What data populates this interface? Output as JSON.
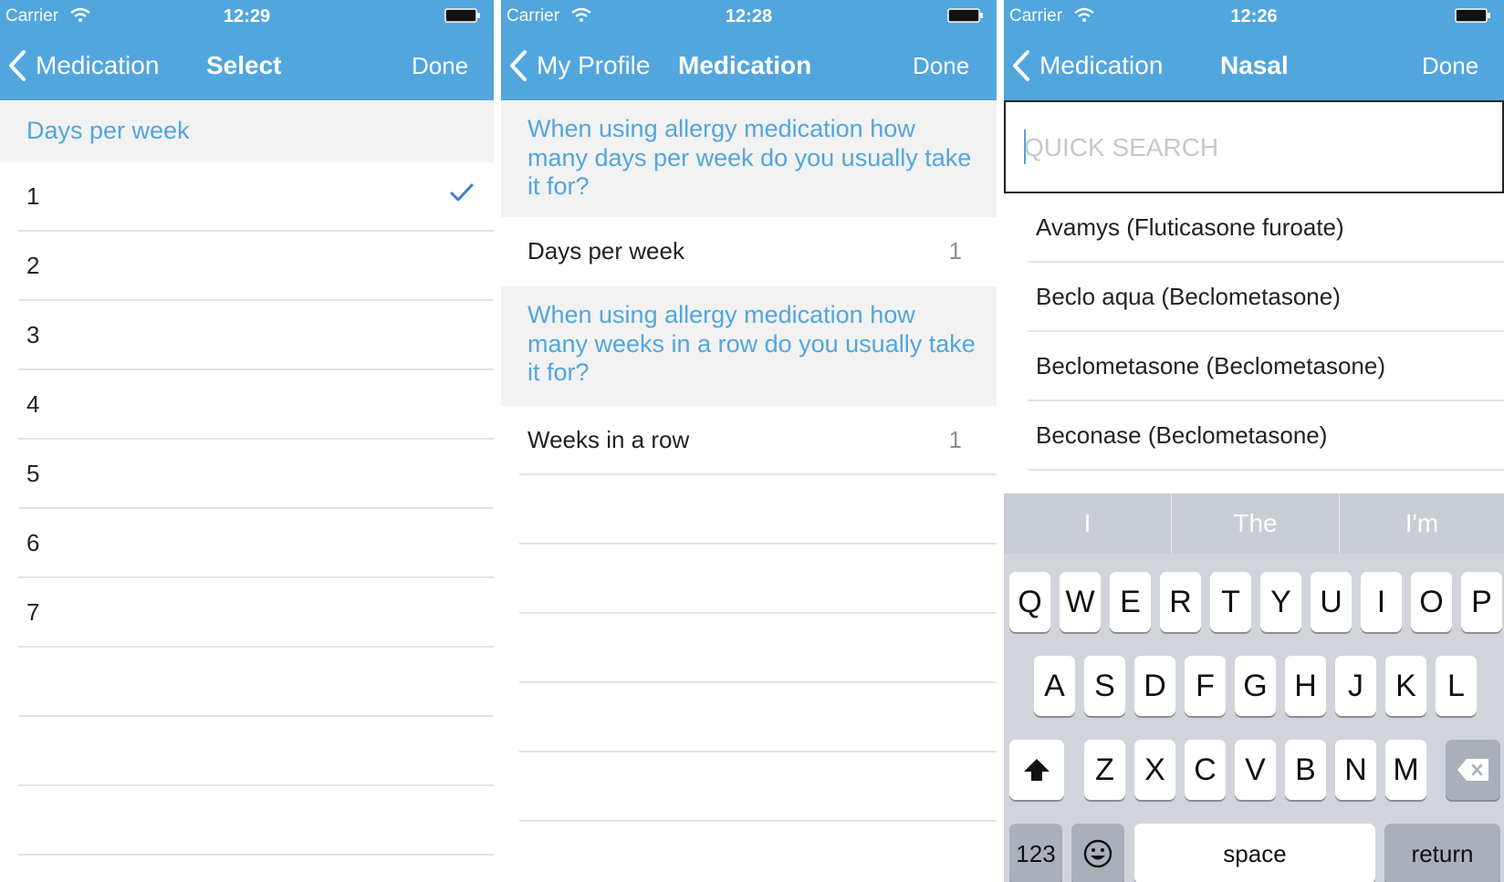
{
  "status_bar": {
    "screen1": {
      "carrier": "Carrier",
      "time": "12:29"
    },
    "screen2": {
      "carrier": "Carrier",
      "time": "12:28"
    },
    "screen3": {
      "carrier": "Carrier",
      "time": "12:26"
    }
  },
  "screen1": {
    "nav": {
      "back_label": "Medication",
      "title": "Select",
      "done_label": "Done"
    },
    "section_header": "Days per week",
    "options": [
      "1",
      "2",
      "3",
      "4",
      "5",
      "6",
      "7"
    ],
    "selected_option": "1"
  },
  "screen2": {
    "nav": {
      "back_label": "My Profile",
      "title": "Medication",
      "done_label": "Done"
    },
    "question1": "When using allergy medication how many days per week do you usually take it for?",
    "row1": {
      "label": "Days per week",
      "value": "1"
    },
    "question2": "When using allergy medication how many weeks in a row do you usually take it for?",
    "row2": {
      "label": "Weeks in a row",
      "value": "1"
    }
  },
  "screen3": {
    "nav": {
      "back_label": "Medication",
      "title": "Nasal",
      "done_label": "Done"
    },
    "search": {
      "placeholder": "QUICK SEARCH",
      "value": ""
    },
    "results": [
      "Avamys (Fluticasone furoate)",
      "Beclo aqua (Beclometasone)",
      "Beclometasone (Beclometasone)",
      "Beconase (Beclometasone)"
    ],
    "keyboard": {
      "suggestions": [
        "I",
        "The",
        "I'm"
      ],
      "row1": [
        "Q",
        "W",
        "E",
        "R",
        "T",
        "Y",
        "U",
        "I",
        "O",
        "P"
      ],
      "row2": [
        "A",
        "S",
        "D",
        "F",
        "G",
        "H",
        "J",
        "K",
        "L"
      ],
      "row3": [
        "Z",
        "X",
        "C",
        "V",
        "B",
        "N",
        "M"
      ],
      "numbers_label": "123",
      "space_label": "space",
      "return_label": "return"
    }
  },
  "colors": {
    "accent": "#52a6de",
    "section_background": "#f2f2f2",
    "keyboard_background": "#d1d5db"
  },
  "icons": [
    "wifi-icon",
    "battery-icon",
    "chevron-left-icon",
    "checkmark-icon",
    "shift-icon",
    "backspace-icon",
    "emoji-icon"
  ]
}
